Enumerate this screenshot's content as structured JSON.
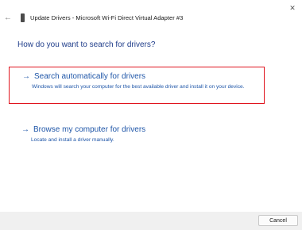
{
  "window": {
    "title": "Update Drivers - Microsoft Wi-Fi Direct Virtual Adapter #3",
    "close_glyph": "✕",
    "back_glyph": "←"
  },
  "heading": "How do you want to search for drivers?",
  "options": [
    {
      "label": "Search automatically for drivers",
      "description": "Windows will search your computer for the best available driver and install it on your device.",
      "highlighted": true,
      "icon": "arrow-right-icon"
    },
    {
      "label": "Browse my computer for drivers",
      "description": "Locate and install a driver manually.",
      "highlighted": false,
      "icon": "arrow-right-icon"
    }
  ],
  "footer": {
    "cancel_label": "Cancel"
  },
  "colors": {
    "link": "#1f56a8",
    "heading": "#1f3d8a",
    "highlight_border": "#e0141e",
    "footer_bg": "#f0f0f0"
  }
}
